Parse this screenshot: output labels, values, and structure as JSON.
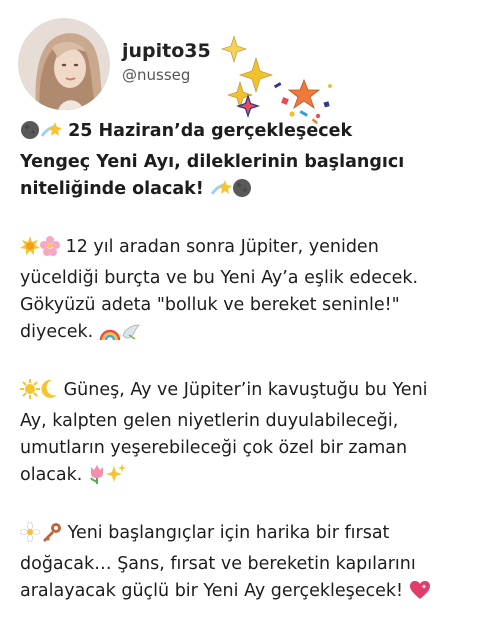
{
  "profile": {
    "username": "jupito35",
    "handle": "@nusseg",
    "avatar_icon": "woman-portrait-avatar"
  },
  "post": {
    "paragraph1": {
      "line1": "25 Haziran’da gerçekleşecek",
      "line2": "Yengeç Yeni Ayı, dileklerinin başlangıcı",
      "line3": "niteliğinde olacak!"
    },
    "paragraph2": {
      "line1": "12 yıl aradan sonra Jüpiter, yeniden",
      "line2": "yüceldiği burçta ve bu Yeni Ay’a eşlik edecek.",
      "line3": "Gökyüzü adeta \"bolluk ve bereket seninle!\"",
      "line4": "diyecek."
    },
    "paragraph3": {
      "line1": "Güneş, Ay ve Jüpiter’in kavuştuğu bu Yeni",
      "line2": "Ay, kalpten gelen niyetlerin duyulabileceği,",
      "line3": "umutların yeşerebileceği çok özel bir zaman",
      "line4": "olacak."
    },
    "paragraph4": {
      "line1": "Yeni başlangıçlar için harika bir fırsat",
      "line2": "doğacak… Şans, fırsat ve bereketin kapılarını",
      "line3": "aralayacak güçlü bir Yeni Ay gerçekleşecek!"
    }
  },
  "colors": {
    "text": "#1d1d1d",
    "handle": "#555555",
    "sparkle": "#f2c12e"
  },
  "icons": [
    "new-moon-icon",
    "shooting-star-icon",
    "sun-icon",
    "cherry-blossom-icon",
    "rainbow-icon",
    "dove-icon",
    "sun-with-face-icon",
    "crescent-moon-icon",
    "tulip-icon",
    "sparkles-icon",
    "daisy-icon",
    "key-icon",
    "heart-icon"
  ]
}
